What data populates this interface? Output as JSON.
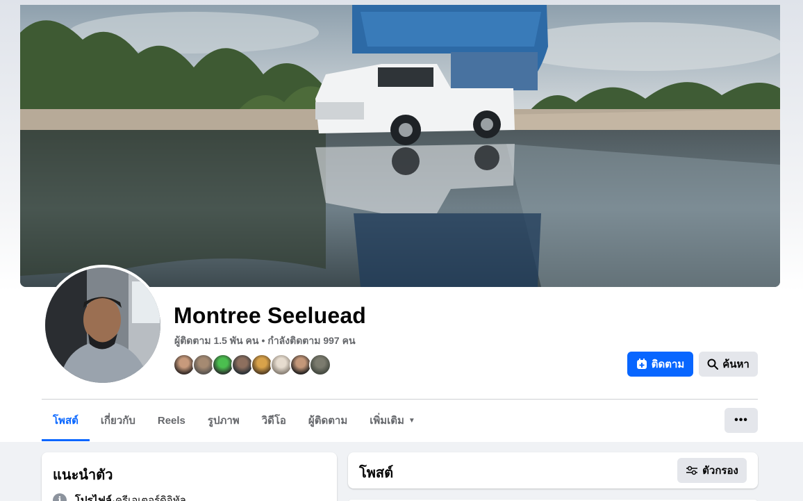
{
  "profile": {
    "name": "Montree Seeluead",
    "followers_text": "ผู้ติดตาม 1.5 พัน คน",
    "separator": "•",
    "following_text": "กำลังติดตาม 997 คน"
  },
  "actions": {
    "follow_label": "ติดตาม",
    "search_label": "ค้นหา"
  },
  "tabs": [
    {
      "label": "โพสต์",
      "active": true
    },
    {
      "label": "เกี่ยวกับ",
      "active": false
    },
    {
      "label": "Reels",
      "active": false
    },
    {
      "label": "รูปภาพ",
      "active": false
    },
    {
      "label": "วิดีโอ",
      "active": false
    },
    {
      "label": "ผู้ติดตาม",
      "active": false
    },
    {
      "label": "เพิ่มเติม",
      "active": false
    }
  ],
  "more_button_label": "•••",
  "intro": {
    "title": "แนะนำตัว",
    "info_label": "โปรไฟล์",
    "info_separator": " · ",
    "info_value": "ครีเอเตอร์ดิจิทัล"
  },
  "posts": {
    "title": "โพสต์",
    "filter_label": "ตัวกรอง"
  },
  "colors": {
    "accent": "#0866ff",
    "secondary_button": "#e4e6eb",
    "muted_text": "#65676b",
    "page_bg": "#f0f2f5"
  },
  "icons": {
    "follow": "add-follow-icon",
    "search": "search-icon",
    "filter": "filter-sliders-icon",
    "info": "info-icon",
    "caret": "caret-down-icon"
  }
}
